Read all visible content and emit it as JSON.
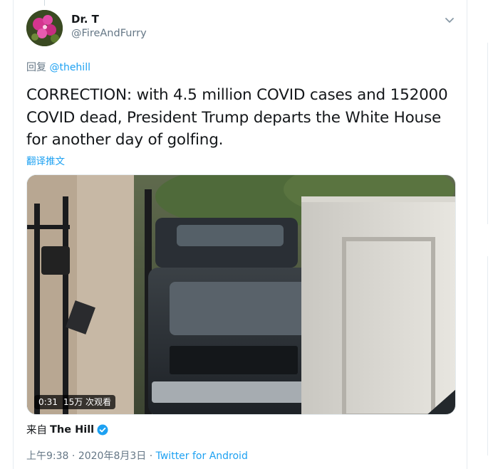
{
  "tweet": {
    "author": {
      "display_name": "Dr. T",
      "handle": "@FireAndFurry"
    },
    "reply_prefix": "回复",
    "reply_to": "@thehill",
    "text": "CORRECTION: with 4.5 million COVID cases and 152000 COVID dead, President Trump departs the White House for another day of golfing.",
    "translate_label": "翻译推文",
    "media": {
      "duration": "0:31",
      "views": "15万 次观看"
    },
    "source": {
      "prefix": "来自",
      "name": "The Hill"
    },
    "meta": {
      "time": "上午9:38",
      "separator": "·",
      "date": "2020年8月3日",
      "client": "Twitter for Android"
    }
  },
  "icons": {
    "caret": "chevron-down-icon",
    "verified": "verified-badge-icon"
  },
  "colors": {
    "link": "#1da1f2",
    "secondary_text": "#657786",
    "primary_text": "#14171a",
    "border": "#e6ecf0"
  }
}
